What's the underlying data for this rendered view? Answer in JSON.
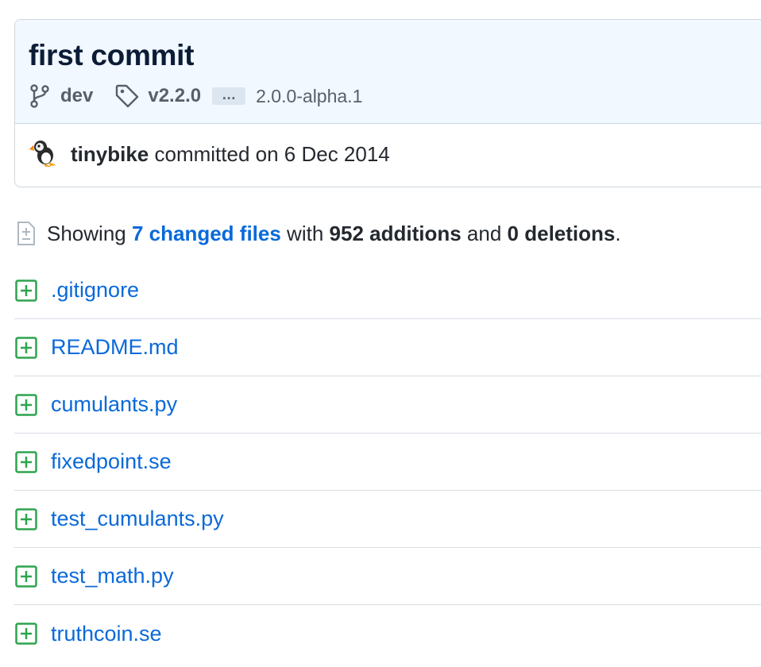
{
  "commit": {
    "title": "first commit",
    "branch": "dev",
    "tag": "v2.2.0",
    "more_refs_label": "…",
    "extra_tag": "2.0.0-alpha.1",
    "author": "tinybike",
    "committed_text": "committed on 6 Dec 2014"
  },
  "summary": {
    "prefix": "Showing",
    "changed_files": "7 changed files",
    "with": "with",
    "additions": "952 additions",
    "and": "and",
    "deletions": "0 deletions",
    "suffix": "."
  },
  "files": [
    {
      "name": ".gitignore",
      "status": "added"
    },
    {
      "name": "README.md",
      "status": "added"
    },
    {
      "name": "cumulants.py",
      "status": "added"
    },
    {
      "name": "fixedpoint.se",
      "status": "added"
    },
    {
      "name": "test_cumulants.py",
      "status": "added"
    },
    {
      "name": "test_math.py",
      "status": "added"
    },
    {
      "name": "truthcoin.se",
      "status": "added"
    }
  ],
  "icons": {
    "branch": "git-branch-icon",
    "tag": "tag-icon",
    "file_added": "diff-added-icon",
    "summary": "file-diff-icon",
    "avatar": "puffin-avatar"
  },
  "colors": {
    "link": "#0969da",
    "added": "#2da44e",
    "header_bg": "#f1f8ff"
  }
}
